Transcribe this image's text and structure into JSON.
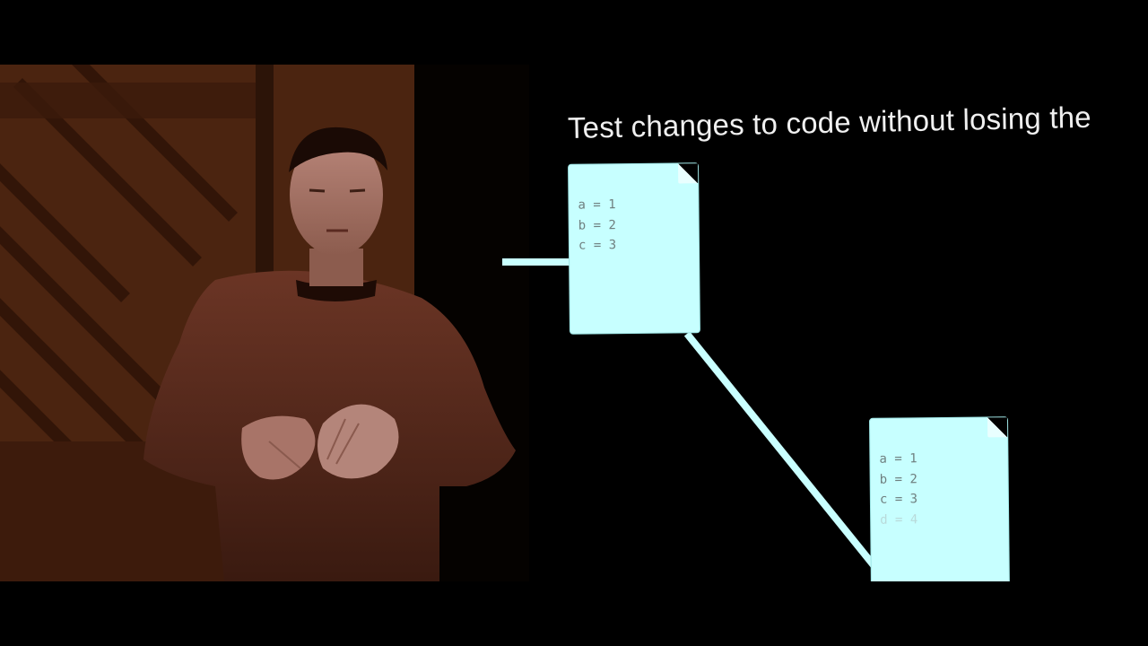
{
  "slide": {
    "title": "Test changes to code without losing the"
  },
  "documents": [
    {
      "lines": [
        "a = 1",
        "b = 2",
        "c = 3"
      ]
    },
    {
      "lines": [
        "a = 1",
        "b = 2",
        "c = 3"
      ],
      "faded_line": "d = 4"
    }
  ],
  "colors": {
    "background": "#000000",
    "document_fill": "#c7ffff",
    "connector": "#c9ffff",
    "title_text": "#f0f0f0",
    "code_text": "#6f7f7f",
    "speaker_tint": "#5a2a14"
  },
  "icons": {
    "document": "file-icon"
  }
}
